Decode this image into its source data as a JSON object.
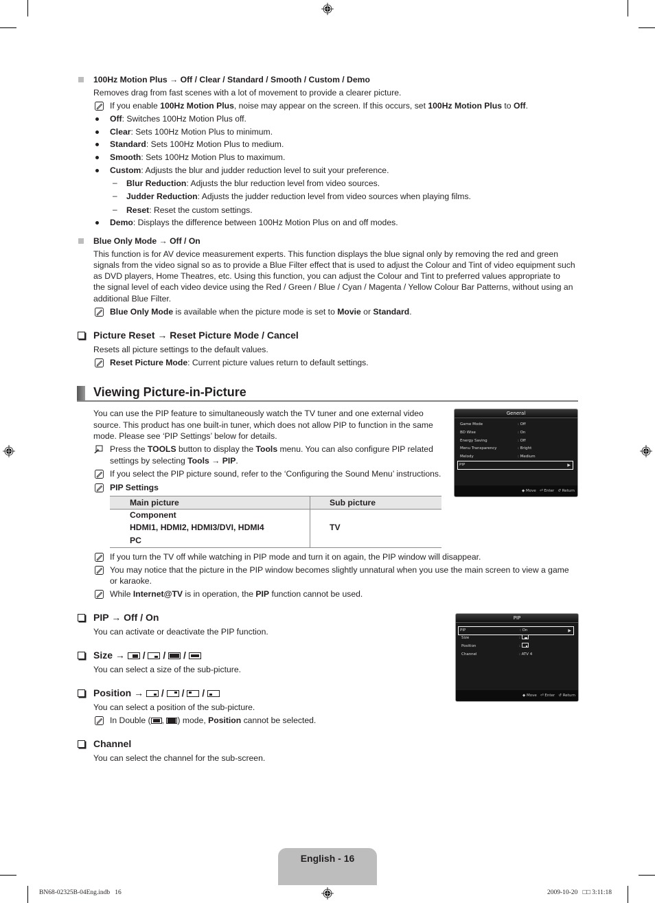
{
  "motion_plus": {
    "heading_name": "100Hz Motion Plus",
    "heading_arrow": " → ",
    "heading_options": "Off / Clear / Standard / Smooth / Custom / Demo",
    "description": "Removes drag from fast scenes with a lot of movement to provide a clearer picture.",
    "note": {
      "pre": "If you enable ",
      "b1": "100Hz Motion Plus",
      "mid": ", noise may appear on the screen. If this occurs, set ",
      "b2": "100Hz Motion Plus",
      "mid2": " to ",
      "b3": "Off",
      "post": "."
    },
    "bullets": [
      {
        "term": "Off",
        "text": ": Switches 100Hz Motion Plus off."
      },
      {
        "term": "Clear",
        "text": ": Sets 100Hz Motion Plus to minimum."
      },
      {
        "term": "Standard",
        "text": ": Sets 100Hz Motion Plus to medium."
      },
      {
        "term": "Smooth",
        "text": ": Sets 100Hz Motion Plus to maximum."
      },
      {
        "term": "Custom",
        "text": ": Adjusts the blur and judder reduction level to suit your preference."
      }
    ],
    "sub_bullets": [
      {
        "term": "Blur Reduction",
        "text": ": Adjusts the blur reduction level from video sources."
      },
      {
        "term": "Judder Reduction",
        "text": ": Adjusts the judder reduction level from video sources when playing films."
      },
      {
        "term": "Reset",
        "text": ": Reset the custom settings."
      }
    ],
    "demo": {
      "term": "Demo",
      "text": ": Displays the difference between 100Hz Motion Plus on and off modes."
    }
  },
  "blue_only": {
    "heading_name": "Blue Only Mode",
    "heading_arrow": " → ",
    "heading_options": "Off / On",
    "lines": [
      "This function is for AV device measurement experts. This function displays the blue signal only by removing the red and green",
      "signals from the video signal so as to provide a Blue Filter effect that is used to adjust the Colour and Tint of video equipment such",
      "as DVD players, Home Theatres, etc. Using this function, you can adjust the Colour and Tint to preferred values appropriate to",
      "the signal level of each video device using the Red / Green / Blue / Cyan / Magenta / Yellow Colour Bar Patterns, without using an",
      "additional Blue Filter."
    ],
    "note": {
      "b1": "Blue Only Mode",
      "mid": " is available when the picture mode is set to ",
      "b2": "Movie",
      "mid2": " or ",
      "b3": "Standard",
      "post": "."
    }
  },
  "picture_reset": {
    "heading": "Picture Reset → Reset Picture Mode / Cancel",
    "description": "Resets all picture settings to the default values.",
    "note": {
      "b1": "Reset Picture Mode",
      "post": ": Current picture values return to default settings."
    }
  },
  "section": {
    "title": "Viewing Picture-in-Picture",
    "intro_lines": [
      "You can use the PIP feature to simultaneously watch the TV tuner and one external video",
      "source. This product has one built-in tuner, which does not allow PIP to function in the same",
      "mode. Please see ‘PIP Settings’ below for details."
    ],
    "tools_note": {
      "p1": "Press the ",
      "b1": "TOOLS",
      "p2": " button to display the ",
      "b2": "Tools",
      "p3": " menu. You can also configure PIP related",
      "p4": "settings by selecting ",
      "b3": "Tools",
      "p5": " → ",
      "b4": "PIP",
      "p6": "."
    },
    "sound_note": "If you select the PIP picture sound, refer to the ‘Configuring the Sound Menu’ instructions.",
    "settings_label": "PIP Settings",
    "table": {
      "headers": [
        "Main picture",
        "Sub picture"
      ],
      "main_rows": [
        "Component",
        "HDMI1, HDMI2, HDMI3/DVI, HDMI4",
        "PC"
      ],
      "sub_value": "TV"
    },
    "notes_after": [
      "If you turn the TV off while watching in PIP mode and turn it on again, the PIP window will disappear.",
      "You may notice that the picture in the PIP window becomes slightly unnatural when you use the main screen to view a game",
      "or karaoke."
    ],
    "internet_note": {
      "p1": "While ",
      "b1": "Internet@TV",
      "p2": " is in operation, the ",
      "b2": "PIP",
      "p3": " function cannot be used."
    }
  },
  "pip_onoff": {
    "heading": "PIP → Off / On",
    "description": "You can activate or deactivate the PIP function."
  },
  "size": {
    "heading": "Size →",
    "separator": "/",
    "description": "You can select a size of the sub-picture."
  },
  "position": {
    "heading": "Position →",
    "separator": "/",
    "description": "You can select a position of the sub-picture.",
    "note": {
      "p1": "In Double (",
      "comma": ", ",
      "p2": ") mode, ",
      "b1": "Position",
      "p3": " cannot be selected."
    }
  },
  "channel": {
    "heading": "Channel",
    "description": "You can select the channel for the sub-screen."
  },
  "menu_general": {
    "title": "General",
    "rows": [
      {
        "label": "Game Mode",
        "value": ": Off"
      },
      {
        "label": "BD Wise",
        "value": ": On"
      },
      {
        "label": "Energy Saving",
        "value": ": Off"
      },
      {
        "label": "Menu Transparency",
        "value": ": Bright"
      },
      {
        "label": "Melody",
        "value": ": Medium"
      },
      {
        "label": "PIP",
        "value": ""
      }
    ],
    "footer": {
      "move": "Move",
      "enter": "Enter",
      "return": "Return"
    }
  },
  "menu_pip": {
    "title": "PIP",
    "rows": [
      {
        "label": "PIP",
        "value": ": On"
      },
      {
        "label": "Size",
        "value": ":"
      },
      {
        "label": "Position",
        "value": ":"
      },
      {
        "label": "Channel",
        "value": ": ATV 4"
      }
    ],
    "footer": {
      "move": "Move",
      "enter": "Enter",
      "return": "Return"
    }
  },
  "footer": {
    "page_label": "English - 16",
    "file": "BN68-02325B-04Eng.indb   16",
    "timestamp": "2009-10-20   □□ 3:11:18"
  },
  "colors": {
    "tab_bg": "#bdbdbd",
    "section_bar": "#808080",
    "menu_bg": "#1a1a1a"
  }
}
